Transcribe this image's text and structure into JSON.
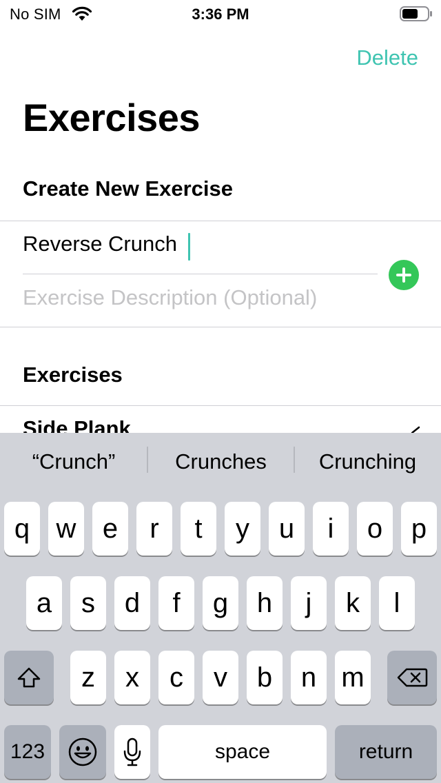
{
  "status_bar": {
    "carrier": "No SIM",
    "time": "3:36 PM",
    "icons": [
      "wifi-icon",
      "battery-icon"
    ]
  },
  "nav": {
    "delete_label": "Delete"
  },
  "page": {
    "title": "Exercises"
  },
  "create_section": {
    "header": "Create New Exercise",
    "name_value": "Reverse Crunch",
    "description_placeholder": "Exercise Description (Optional)",
    "add_icon": "plus-circle-icon"
  },
  "list_section": {
    "header": "Exercises",
    "items": [
      {
        "name": "Side Plank",
        "icon": "edit-icon"
      }
    ]
  },
  "keyboard": {
    "suggestions": [
      "“Crunch”",
      "Crunches",
      "Crunching"
    ],
    "row1": [
      "q",
      "w",
      "e",
      "r",
      "t",
      "y",
      "u",
      "i",
      "o",
      "p"
    ],
    "row2": [
      "a",
      "s",
      "d",
      "f",
      "g",
      "h",
      "j",
      "k",
      "l"
    ],
    "row3": [
      "z",
      "x",
      "c",
      "v",
      "b",
      "n",
      "m"
    ],
    "numbers_label": "123",
    "space_label": "space",
    "return_label": "return",
    "icons": [
      "shift-icon",
      "backspace-icon",
      "emoji-icon",
      "microphone-icon"
    ]
  },
  "colors": {
    "accent": "#3fc4b1",
    "add_button": "#34c759",
    "keyboard_bg": "#d1d3d9",
    "placeholder": "#c4c4c6"
  }
}
